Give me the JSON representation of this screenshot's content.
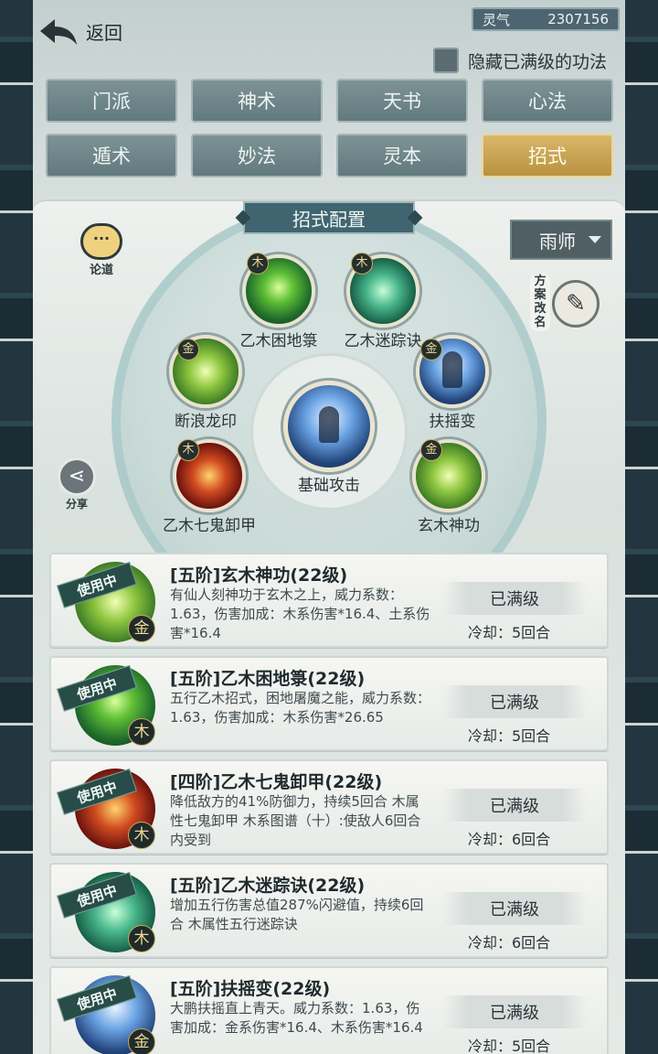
{
  "header": {
    "back_label": "返回",
    "currency_label": "灵气",
    "currency_value": "2307156"
  },
  "hide_maxed_label": "隐藏已满级的功法",
  "tabs": [
    "门派",
    "神术",
    "天书",
    "心法",
    "遁术",
    "妙法",
    "灵本",
    "招式"
  ],
  "active_tab": "招式",
  "panel": {
    "title": "招式配置",
    "discuss_label": "论道",
    "share_label": "分享",
    "plan_select": "雨师",
    "rename_label": "方案改名"
  },
  "wheel": {
    "center": {
      "name": "基础攻击"
    },
    "skills": [
      {
        "name": "乙木困地箓",
        "element": "木"
      },
      {
        "name": "乙木迷踪诀",
        "element": "木"
      },
      {
        "name": "断浪龙印",
        "element": "金"
      },
      {
        "name": "扶摇变",
        "element": "金"
      },
      {
        "name": "乙木七鬼卸甲",
        "element": "木"
      },
      {
        "name": "玄木神功",
        "element": "金"
      }
    ]
  },
  "cards": [
    {
      "status": "使用中",
      "title": "[五阶]玄木神功(22级)",
      "desc": "有仙人刻神功于玄木之上，威力系数：1.63，伤害加成：木系伤害*16.4、土系伤害*16.4",
      "max_label": "已满级",
      "cooldown": "冷却：5回合",
      "element": "金"
    },
    {
      "status": "使用中",
      "title": "[五阶]乙木困地箓(22级)",
      "desc": "五行乙木招式，困地屠魔之能，威力系数：1.63，伤害加成：木系伤害*26.65",
      "max_label": "已满级",
      "cooldown": "冷却：5回合",
      "element": "木"
    },
    {
      "status": "使用中",
      "title": "[四阶]乙木七鬼卸甲(22级)",
      "desc": "降低敌方的41%防御力，持续5回合 木属性七鬼卸甲 木系图谱（十）:使敌人6回合内受到",
      "max_label": "已满级",
      "cooldown": "冷却：6回合",
      "element": "木"
    },
    {
      "status": "使用中",
      "title": "[五阶]乙木迷踪诀(22级)",
      "desc": "增加五行伤害总值287%闪避值，持续6回合 木属性五行迷踪诀",
      "max_label": "已满级",
      "cooldown": "冷却：6回合",
      "element": "木"
    },
    {
      "status": "使用中",
      "title": "[五阶]扶摇变(22级)",
      "desc": "大鹏扶摇直上青天。威力系数：1.63，伤害加成：金系伤害*16.4、木系伤害*16.4",
      "max_label": "已满级",
      "cooldown": "冷却：5回合",
      "element": "金"
    }
  ]
}
